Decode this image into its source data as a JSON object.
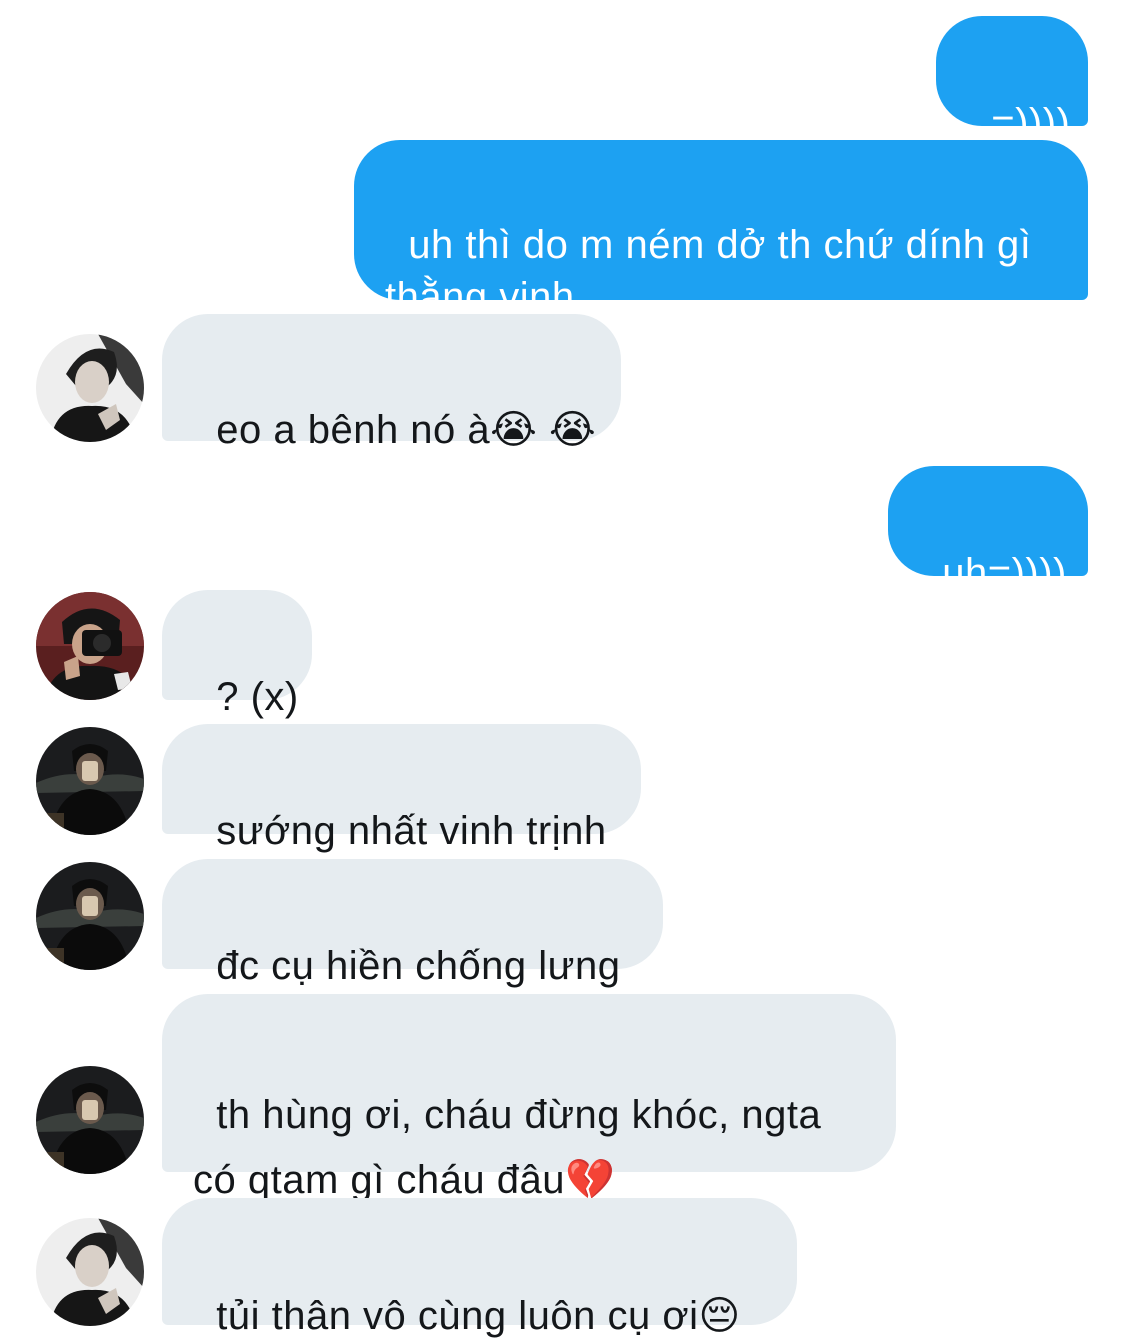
{
  "conversation": {
    "messages": [
      {
        "side": "outgoing",
        "text": "=))))"
      },
      {
        "side": "outgoing",
        "text": "uh thì do m ném dở th chứ dính gì\nthằng vinh"
      },
      {
        "side": "incoming",
        "text": "eo a bênh nó à😭 😭",
        "avatar": "avatar-light-portrait"
      },
      {
        "side": "outgoing",
        "text": "uh=))))"
      },
      {
        "side": "incoming",
        "text": "? (x)",
        "avatar": "avatar-camera-selfie"
      },
      {
        "side": "incoming",
        "text": "sướng nhất vinh trịnh",
        "avatar": "avatar-dark-mirror"
      },
      {
        "side": "incoming",
        "text": "đc cụ hiền chống lưng",
        "avatar": "avatar-dark-mirror"
      },
      {
        "side": "incoming",
        "text": "th hùng ơi, cháu đừng khóc, ngta\ncó qtam gì cháu đâu💔",
        "avatar": "avatar-dark-mirror"
      },
      {
        "side": "incoming",
        "text": "tủi thân vô cùng luôn cụ ơi😔",
        "avatar": "avatar-light-portrait"
      }
    ]
  },
  "colors": {
    "outgoing_bubble": "#1da1f2",
    "incoming_bubble": "#e6ecf0",
    "outgoing_text": "#ffffff",
    "incoming_text": "#14171a",
    "background": "#ffffff"
  }
}
